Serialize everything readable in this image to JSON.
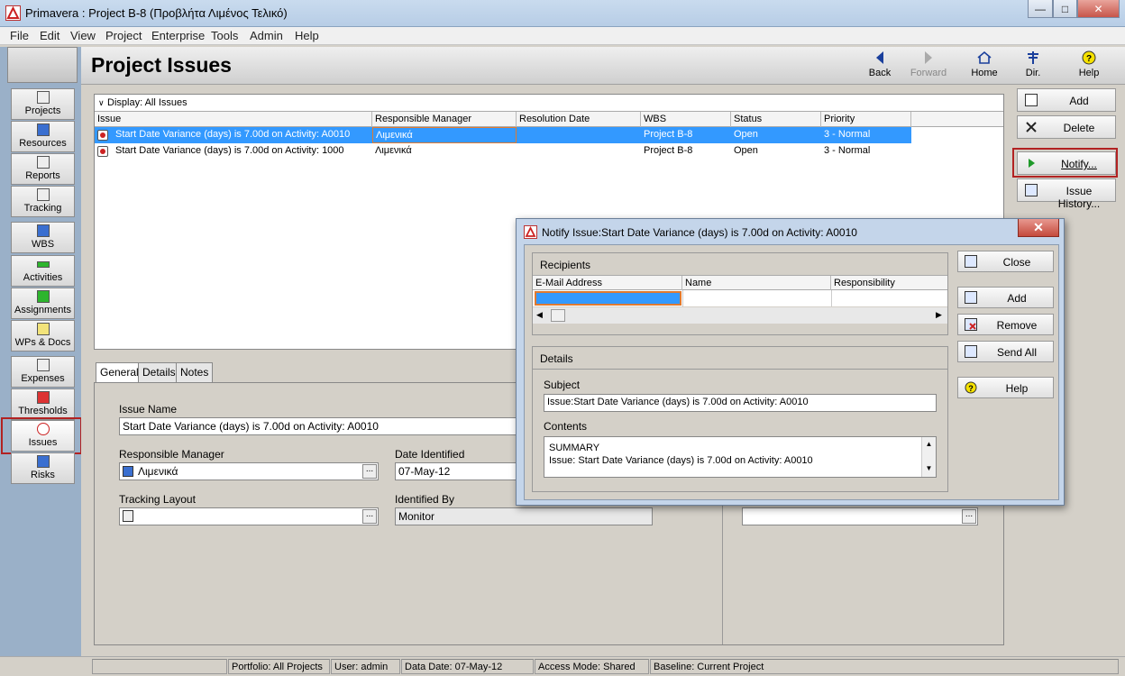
{
  "window": {
    "title": "Primavera : Project B-8 (Προβλήτα Λιμένος Τελικό)",
    "minimize": "—",
    "maximize": "□",
    "close": "✕"
  },
  "menu": [
    "File",
    "Edit",
    "View",
    "Project",
    "Enterprise",
    "Tools",
    "Admin",
    "Help"
  ],
  "header": {
    "title": "Project Issues",
    "nav": [
      {
        "label": "Back",
        "icon": "back-arrow-icon",
        "enabled": true
      },
      {
        "label": "Forward",
        "icon": "forward-arrow-icon",
        "enabled": false
      },
      {
        "label": "Home",
        "icon": "home-icon",
        "enabled": true
      },
      {
        "label": "Dir.",
        "icon": "directory-icon",
        "enabled": true
      },
      {
        "label": "Help",
        "icon": "help-icon",
        "enabled": true
      }
    ]
  },
  "sidebar": [
    {
      "label": "Projects",
      "icon": "projects-icon"
    },
    {
      "label": "Resources",
      "icon": "resources-icon"
    },
    {
      "label": "Reports",
      "icon": "reports-icon"
    },
    {
      "label": "Tracking",
      "icon": "tracking-icon"
    },
    {
      "label": "WBS",
      "icon": "wbs-icon"
    },
    {
      "label": "Activities",
      "icon": "activities-icon"
    },
    {
      "label": "Assignments",
      "icon": "assignments-icon"
    },
    {
      "label": "WPs & Docs",
      "icon": "wps-docs-icon"
    },
    {
      "label": "Expenses",
      "icon": "expenses-icon"
    },
    {
      "label": "Thresholds",
      "icon": "thresholds-icon"
    },
    {
      "label": "Issues",
      "icon": "issues-icon",
      "selected": true
    },
    {
      "label": "Risks",
      "icon": "risks-icon"
    }
  ],
  "grid": {
    "display_label": "Display: All Issues",
    "columns": [
      "Issue",
      "Responsible Manager",
      "Resolution Date",
      "WBS",
      "Status",
      "Priority"
    ],
    "rows": [
      {
        "issue": "Start Date Variance (days) is 7.00d on Activity: A0010",
        "manager": "Λιμενικά",
        "resolution_date": "",
        "wbs": "Project B-8",
        "status": "Open",
        "priority": "3 - Normal",
        "selected": true
      },
      {
        "issue": "Start Date Variance (days) is 7.00d on Activity: 1000",
        "manager": "Λιμενικά",
        "resolution_date": "",
        "wbs": "Project B-8",
        "status": "Open",
        "priority": "3 - Normal",
        "selected": false
      }
    ]
  },
  "right_buttons": [
    {
      "label": "Add",
      "icon": "add-icon"
    },
    {
      "label": "Delete",
      "icon": "delete-icon"
    },
    {
      "label": "Notify...",
      "icon": "notify-icon",
      "highlighted": true
    },
    {
      "label": "Issue History...",
      "icon": "issue-history-icon"
    }
  ],
  "detail": {
    "tabs": [
      "General",
      "Details",
      "Notes"
    ],
    "active_tab": "General",
    "issue_name_label": "Issue Name",
    "issue_name_value": "Start Date Variance (days) is 7.00d on Activity: A0010",
    "responsible_manager_label": "Responsible Manager",
    "responsible_manager_value": "Λιμενικά",
    "date_identified_label": "Date Identified",
    "date_identified_value": "07-May-12",
    "tracking_layout_label": "Tracking Layout",
    "tracking_layout_value": "",
    "identified_by_label": "Identified By",
    "identified_by_value": "Monitor",
    "ellipsis": "..."
  },
  "dialog": {
    "title": "Notify Issue:Start Date Variance (days) is 7.00d on Activity: A0010",
    "close_x": "✕",
    "recipients_label": "Recipients",
    "recipient_columns": [
      "E-Mail Address",
      "Name",
      "Responsibility"
    ],
    "details_label": "Details",
    "subject_label": "Subject",
    "subject_value": "Issue:Start Date Variance (days) is 7.00d on Activity: A0010",
    "contents_label": "Contents",
    "contents_line1": "SUMMARY",
    "contents_line2": "Issue:  Start Date Variance (days) is 7.00d on Activity: A0010",
    "buttons": [
      {
        "label": "Close",
        "icon": "close-icon"
      },
      {
        "label": "Add",
        "icon": "add-recipient-icon"
      },
      {
        "label": "Remove",
        "icon": "remove-recipient-icon"
      },
      {
        "label": "Send All",
        "icon": "send-all-icon"
      },
      {
        "label": "Help",
        "icon": "help-icon"
      }
    ]
  },
  "status_bar": {
    "portfolio": "Portfolio: All Projects",
    "user": "User: admin",
    "data_date": "Data Date: 07-May-12",
    "access_mode": "Access Mode: Shared",
    "baseline": "Baseline: Current Project"
  },
  "colors": {
    "selection": "#3399ff",
    "highlight_border": "#b22222",
    "sidebar_bg": "#9ab0c8"
  }
}
